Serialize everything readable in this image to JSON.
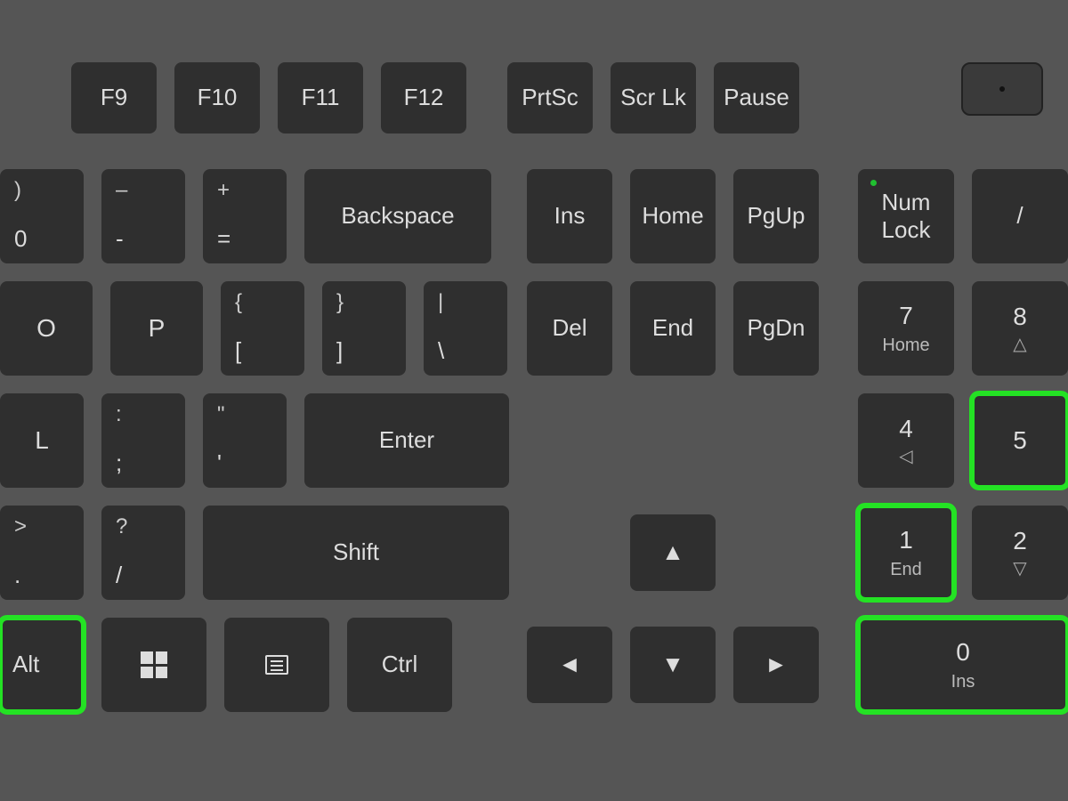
{
  "colors": {
    "highlight": "#24e224",
    "key_bg": "#2f2f2f",
    "board_bg": "#555555"
  },
  "highlighted_keys": [
    "alt-left",
    "numpad-5",
    "numpad-1",
    "numpad-0"
  ],
  "function_row": {
    "f9": "F9",
    "f10": "F10",
    "f11": "F11",
    "f12": "F12",
    "prtsc": "PrtSc",
    "scrlk": "Scr Lk",
    "pause": "Pause"
  },
  "row2": {
    "zero": {
      "top": ")",
      "bot": "0"
    },
    "minus": {
      "top": "–",
      "bot": "-"
    },
    "equals": {
      "top": "+",
      "bot": "="
    },
    "backspace": "Backspace",
    "ins": "Ins",
    "home": "Home",
    "pgup": "PgUp",
    "numlock": {
      "line1": "Num",
      "line2": "Lock"
    },
    "numdiv": "/"
  },
  "row3": {
    "o": "O",
    "p": "P",
    "lbracket": {
      "top": "{",
      "bot": "["
    },
    "rbracket": {
      "top": "}",
      "bot": "]"
    },
    "backslash": {
      "top": "|",
      "bot": "\\"
    },
    "del": "Del",
    "end": "End",
    "pgdn": "PgDn",
    "num7": {
      "main": "7",
      "sub": "Home"
    },
    "num8": {
      "main": "8",
      "arrow": "△"
    }
  },
  "row4": {
    "l": "L",
    "semicolon": {
      "top": ":",
      "bot": ";"
    },
    "quote": {
      "top": "\"",
      "bot": "'"
    },
    "enter": "Enter",
    "num4": {
      "main": "4",
      "arrow": "◁"
    },
    "num5": {
      "main": "5"
    }
  },
  "row5": {
    "period": {
      "top": ">",
      "bot": "."
    },
    "slash": {
      "top": "?",
      "bot": "/"
    },
    "shift": "Shift",
    "up": "▲",
    "num1": {
      "main": "1",
      "sub": "End"
    },
    "num2": {
      "main": "2",
      "arrow": "▽"
    }
  },
  "row6": {
    "alt": "Alt",
    "ctrl": "Ctrl",
    "left": "◄",
    "down": "▼",
    "right": "►",
    "num0": {
      "main": "0",
      "sub": "Ins"
    }
  },
  "icons": {
    "windows": "windows-logo",
    "context_menu": "context-menu"
  }
}
